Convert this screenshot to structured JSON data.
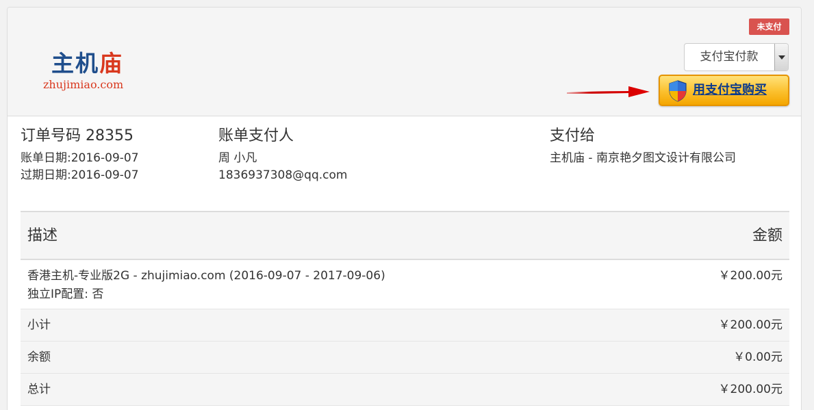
{
  "header": {
    "logo": {
      "chars": [
        "主",
        "机",
        "庙"
      ],
      "domain": "zhujimiao.com"
    },
    "status": "未支付",
    "payment_method": "支付宝付款",
    "pay_button_label": "用支付宝购买"
  },
  "order": {
    "title": "订单号码 28355",
    "invoice_date": "账单日期:2016-09-07",
    "due_date": "过期日期:2016-09-07"
  },
  "payer": {
    "title": "账单支付人",
    "name": "周 小凡",
    "email": "1836937308@qq.com"
  },
  "payee": {
    "title": "支付给",
    "name": "主机庙 - 南京艳夕图文设计有限公司"
  },
  "items": {
    "header": {
      "desc": "描述",
      "amount": "金额"
    },
    "rows": [
      {
        "desc": "香港主机-专业版2G - zhujimiao.com (2016-09-07 - 2017-09-06)",
        "detail": "独立IP配置: 否",
        "amount": "￥200.00元"
      }
    ],
    "subtotal": {
      "label": "小计",
      "amount": "￥200.00元"
    },
    "credit": {
      "label": "余额",
      "amount": "￥0.00元"
    },
    "total": {
      "label": "总计",
      "amount": "￥200.00元"
    }
  },
  "colors": {
    "badge": "#d9534f",
    "button_gold": "#fbc02d",
    "button_text": "#0b3a8c",
    "arrow": "#cc0000",
    "logo_blue": "#1f4e8c",
    "logo_red": "#d9381e"
  },
  "icons": [
    "red-arrow-icon",
    "shield-icon",
    "dropdown-arrow-icon"
  ]
}
